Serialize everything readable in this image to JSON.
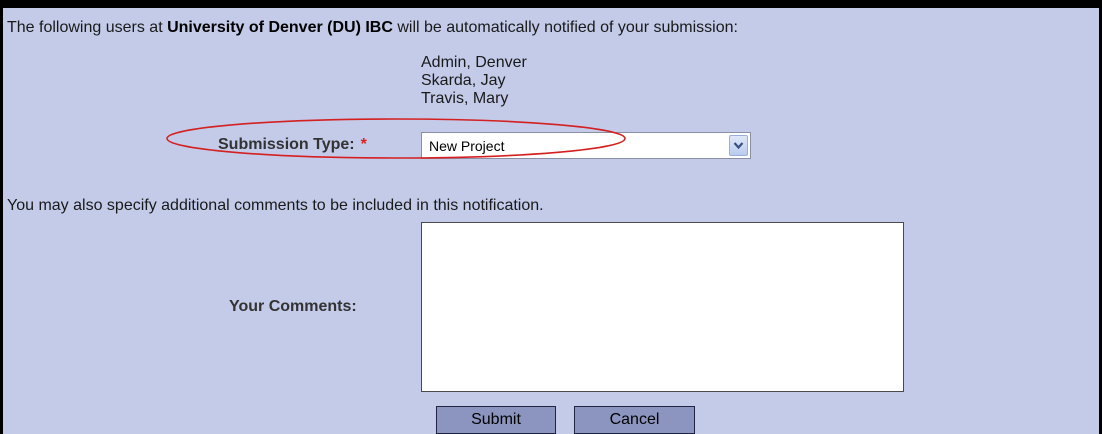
{
  "notification": {
    "prefix": "The following users at ",
    "institution": "University of Denver (DU) IBC",
    "suffix": " will be automatically notified of your submission:",
    "users": [
      "Admin, Denver",
      "Skarda, Jay",
      "Travis, Mary"
    ]
  },
  "submission_type": {
    "label": "Submission Type:",
    "required_marker": "*",
    "selected_value": "New Project",
    "dropdown_icon": "chevron-down-icon"
  },
  "comments": {
    "note": "You may also specify additional comments to be included in this notification.",
    "label": "Your Comments:",
    "value": ""
  },
  "buttons": {
    "submit": "Submit",
    "cancel": "Cancel"
  },
  "colors": {
    "panel_background": "#c3cbe9",
    "button_background": "#8b95bf",
    "required_marker": "#e02020",
    "highlight_ellipse": "#d42020"
  }
}
